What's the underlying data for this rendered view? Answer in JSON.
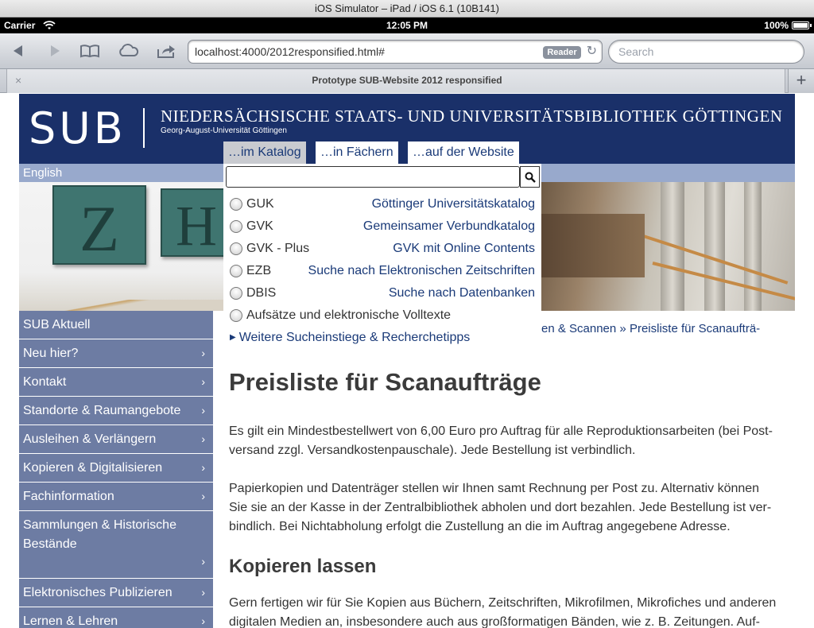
{
  "simulator": {
    "title": "iOS Simulator – iPad / iOS 6.1 (10B141)"
  },
  "status_bar": {
    "carrier": "Carrier",
    "time": "12:05 PM",
    "battery": "100%"
  },
  "browser": {
    "url": "localhost:4000/2012responsified.html#",
    "reader_label": "Reader",
    "search_placeholder": "Search",
    "tab_title": "Prototype SUB-Website 2012 responsified",
    "new_tab": "+",
    "close_tab": "×"
  },
  "header": {
    "logo": "SUB",
    "library_name": "NIEDERSÄCHSISCHE STAATS- UND UNIVERSITÄTSBIBLIOTHEK GÖTTINGEN",
    "university": "Georg-August-Universität Göttingen",
    "search_tabs": [
      "…im Katalog",
      "…in Fächern",
      "…auf der Website"
    ],
    "language_link": "English"
  },
  "search_dropdown": {
    "options": [
      {
        "code": "GUK",
        "desc": "Göttinger Universitätskatalog"
      },
      {
        "code": "GVK",
        "desc": "Gemeinsamer Verbundkatalog"
      },
      {
        "code": "GVK - Plus",
        "desc": "GVK mit Online Contents"
      },
      {
        "code": "EZB",
        "desc": "Suche nach Elektronischen Zeitschriften"
      },
      {
        "code": "DBIS",
        "desc": "Suche nach Datenbanken"
      },
      {
        "code": "Aufsätze und elektronische Volltexte",
        "desc": ""
      }
    ],
    "more_link": "Weitere Sucheinstiege & Recherchetipps"
  },
  "nav": {
    "items": [
      {
        "label": "SUB Aktuell",
        "chevron": ""
      },
      {
        "label": "Neu hier?",
        "chevron": "›"
      },
      {
        "label": "Kontakt",
        "chevron": "›"
      },
      {
        "label": "Standorte & Raumangebote",
        "chevron": "›"
      },
      {
        "label": "Ausleihen & Verlängern",
        "chevron": "›"
      },
      {
        "label": "Kopieren & Digitalisieren",
        "chevron": "›"
      },
      {
        "label": "Fachinformation",
        "chevron": "›"
      },
      {
        "label": "Sammlungen & Historische Bestände",
        "chevron": "›"
      },
      {
        "label": "Elektronisches Publizieren",
        "chevron": "›"
      },
      {
        "label": "Lernen & Lehren",
        "chevron": "›"
      }
    ]
  },
  "breadcrumb": {
    "partial": "en & Scannen",
    "separator": "»",
    "current": "Preisliste für Scanaufträ-"
  },
  "content": {
    "title": "Preisliste für Scanaufträge",
    "para1": "Es gilt ein Mindestbestellwert von 6,00 Euro pro Auftrag für alle Reproduktionsarbeiten (bei Post-versand zzgl. Versandkostenpauschale). Jede Bestellung ist verbindlich.",
    "para2": "Papierkopien und Datenträger stellen wir Ihnen samt Rechnung per Post zu. Alternativ können Sie sie an der Kasse in der Zentralbibliothek abholen und dort bezahlen. Jede Bestellung ist ver-bindlich. Bei Nichtabholung erfolgt die Zustellung an die im Auftrag angegebene Adresse.",
    "subtitle": "Kopieren lassen",
    "para3": "Gern fertigen wir für Sie Kopien aus Büchern, Zeitschriften, Mikrofilmen, Mikrofiches und anderen digitalen Medien an, insbesondere auch aus großformatigen Bänden, wie z. B. Zeitungen. Auf-"
  },
  "image_tiles": {
    "left": "Z",
    "right": "H"
  },
  "colors": {
    "banner": "#1a3069",
    "nav": "#6d7ca3",
    "lang_bar": "#98a9cc",
    "link": "#1a3a78"
  }
}
